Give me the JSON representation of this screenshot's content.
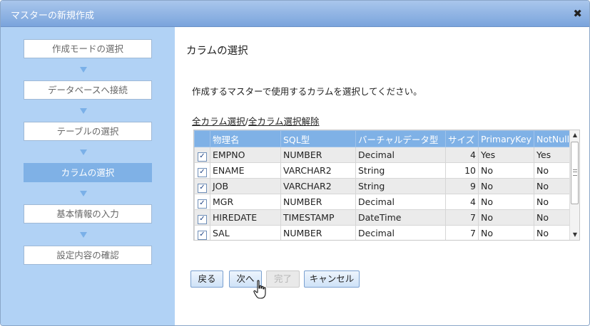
{
  "dialog": {
    "title": "マスターの新規作成",
    "close_label": "✖"
  },
  "steps": [
    {
      "label": "作成モードの選択"
    },
    {
      "label": "データベースへ接続"
    },
    {
      "label": "テーブルの選択"
    },
    {
      "label": "カラムの選択"
    },
    {
      "label": "基本情報の入力"
    },
    {
      "label": "設定内容の確認"
    }
  ],
  "active_step": "カラムの選択",
  "main": {
    "heading": "カラムの選択",
    "description": "作成するマスターで使用するカラムを選択してください。",
    "select_all": "全カラム選択",
    "separator": "/",
    "deselect_all": "全カラム選択解除"
  },
  "table": {
    "headers": [
      "物理名",
      "SQL型",
      "バーチャルデータ型",
      "サイズ",
      "PrimaryKey",
      "NotNull"
    ],
    "rows": [
      {
        "checked": true,
        "name": "EMPNO",
        "sql": "NUMBER",
        "vtype": "Decimal",
        "size": "4",
        "pk": "Yes",
        "nn": "Yes"
      },
      {
        "checked": true,
        "name": "ENAME",
        "sql": "VARCHAR2",
        "vtype": "String",
        "size": "10",
        "pk": "No",
        "nn": "No"
      },
      {
        "checked": true,
        "name": "JOB",
        "sql": "VARCHAR2",
        "vtype": "String",
        "size": "9",
        "pk": "No",
        "nn": "No"
      },
      {
        "checked": true,
        "name": "MGR",
        "sql": "NUMBER",
        "vtype": "Decimal",
        "size": "4",
        "pk": "No",
        "nn": "No"
      },
      {
        "checked": true,
        "name": "HIREDATE",
        "sql": "TIMESTAMP",
        "vtype": "DateTime",
        "size": "7",
        "pk": "No",
        "nn": "No"
      },
      {
        "checked": true,
        "name": "SAL",
        "sql": "NUMBER",
        "vtype": "Decimal",
        "size": "7",
        "pk": "No",
        "nn": "No"
      }
    ]
  },
  "buttons": {
    "back": "戻る",
    "next": "次へ",
    "finish": "完了",
    "cancel": "キャンセル"
  },
  "colors": {
    "titlebar": "#7aa4dc",
    "sidebar": "#b1d2f5",
    "active_step": "#7fb1e6",
    "header": "#7fb1e6"
  },
  "icons": {
    "close": "close-icon",
    "step_arrow": "arrow-down-icon",
    "cursor": "hand-pointer-icon"
  }
}
